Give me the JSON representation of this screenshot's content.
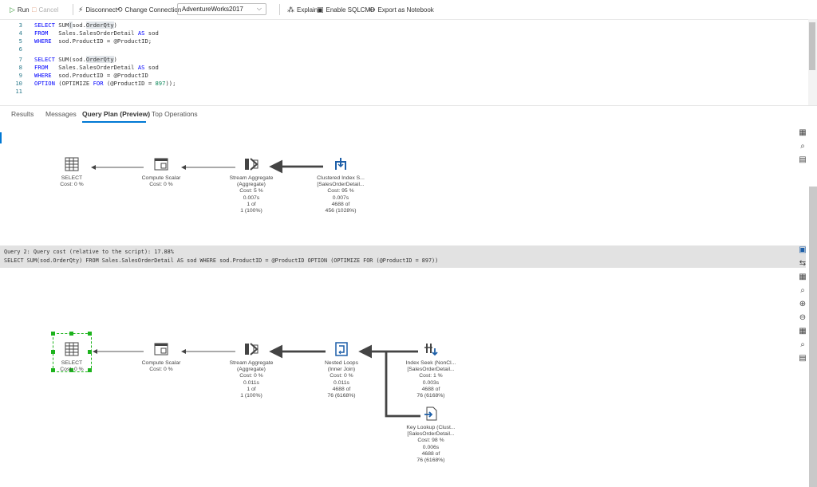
{
  "toolbar": {
    "run_label": "Run",
    "cancel_label": "Cancel",
    "disconnect_label": "Disconnect",
    "change_connection_label": "Change Connection",
    "database": "AdventureWorks2017",
    "explain_label": "Explain",
    "enable_sqlcmd_label": "Enable SQLCMD",
    "export_notebook_label": "Export as Notebook"
  },
  "editor": {
    "lines": [
      {
        "num": "3",
        "text": "SELECT SUM(sod.OrderQty)"
      },
      {
        "num": "4",
        "text": "FROM   Sales.SalesOrderDetail AS sod"
      },
      {
        "num": "5",
        "text": "WHERE  sod.ProductID = @ProductID;"
      },
      {
        "num": "6",
        "text": ""
      },
      {
        "num": "7",
        "text": "SELECT SUM(sod.OrderQty)"
      },
      {
        "num": "8",
        "text": "FROM   Sales.SalesOrderDetail AS sod"
      },
      {
        "num": "9",
        "text": "WHERE  sod.ProductID = @ProductID"
      },
      {
        "num": "10",
        "text": "OPTION (OPTIMIZE FOR (@ProductID = 897));"
      },
      {
        "num": "11",
        "text": ""
      }
    ]
  },
  "tabs": [
    {
      "label": "Results"
    },
    {
      "label": "Messages"
    },
    {
      "label": "Query Plan (Preview)"
    },
    {
      "label": "Top Operations"
    }
  ],
  "plan1": {
    "select": {
      "title": "SELECT",
      "cost": "Cost: 0 %"
    },
    "compute": {
      "title": "Compute Scalar",
      "cost": "Cost: 0 %"
    },
    "aggregate": {
      "title": "Stream Aggregate",
      "sub": "(Aggregate)",
      "cost": "Cost: 5 %",
      "time": "0.007s",
      "rows": "1 of",
      "est": "1 (100%)"
    },
    "scan": {
      "title": "Clustered Index S...",
      "sub": "[SalesOrderDetail...",
      "cost": "Cost: 95 %",
      "time": "0.007s",
      "rows": "4688 of",
      "est": "456 (1028%)"
    }
  },
  "query2": {
    "header": "Query 2: Query cost (relative to the script): 17.88%",
    "sql": "SELECT SUM(sod.OrderQty) FROM Sales.SalesOrderDetail AS sod WHERE sod.ProductID = @ProductID OPTION (OPTIMIZE FOR (@ProductID = 897))"
  },
  "plan2": {
    "select": {
      "title": "SELECT",
      "cost": "Cost: 0 %"
    },
    "compute": {
      "title": "Compute Scalar",
      "cost": "Cost: 0 %"
    },
    "aggregate": {
      "title": "Stream Aggregate",
      "sub": "(Aggregate)",
      "cost": "Cost: 0 %",
      "time": "0.011s",
      "rows": "1 of",
      "est": "1 (100%)"
    },
    "loops": {
      "title": "Nested Loops",
      "sub": "(Inner Join)",
      "cost": "Cost: 0 %",
      "time": "0.011s",
      "rows": "4688 of",
      "est": "76 (6168%)"
    },
    "seek": {
      "title": "Index Seek (NonCl...",
      "sub": "[SalesOrderDetail...",
      "cost": "Cost: 1 %",
      "time": "0.003s",
      "rows": "4688 of",
      "est": "76 (6168%)"
    },
    "lookup": {
      "title": "Key Lookup (Clust...",
      "sub": "[SalesOrderDetail...",
      "cost": "Cost: 98 %",
      "time": "0.006s",
      "rows": "4688 of",
      "est": "76 (6168%)"
    }
  },
  "colors": {
    "accent": "#0078d4",
    "run": "#3c9a3c",
    "selection": "#1db31d"
  }
}
